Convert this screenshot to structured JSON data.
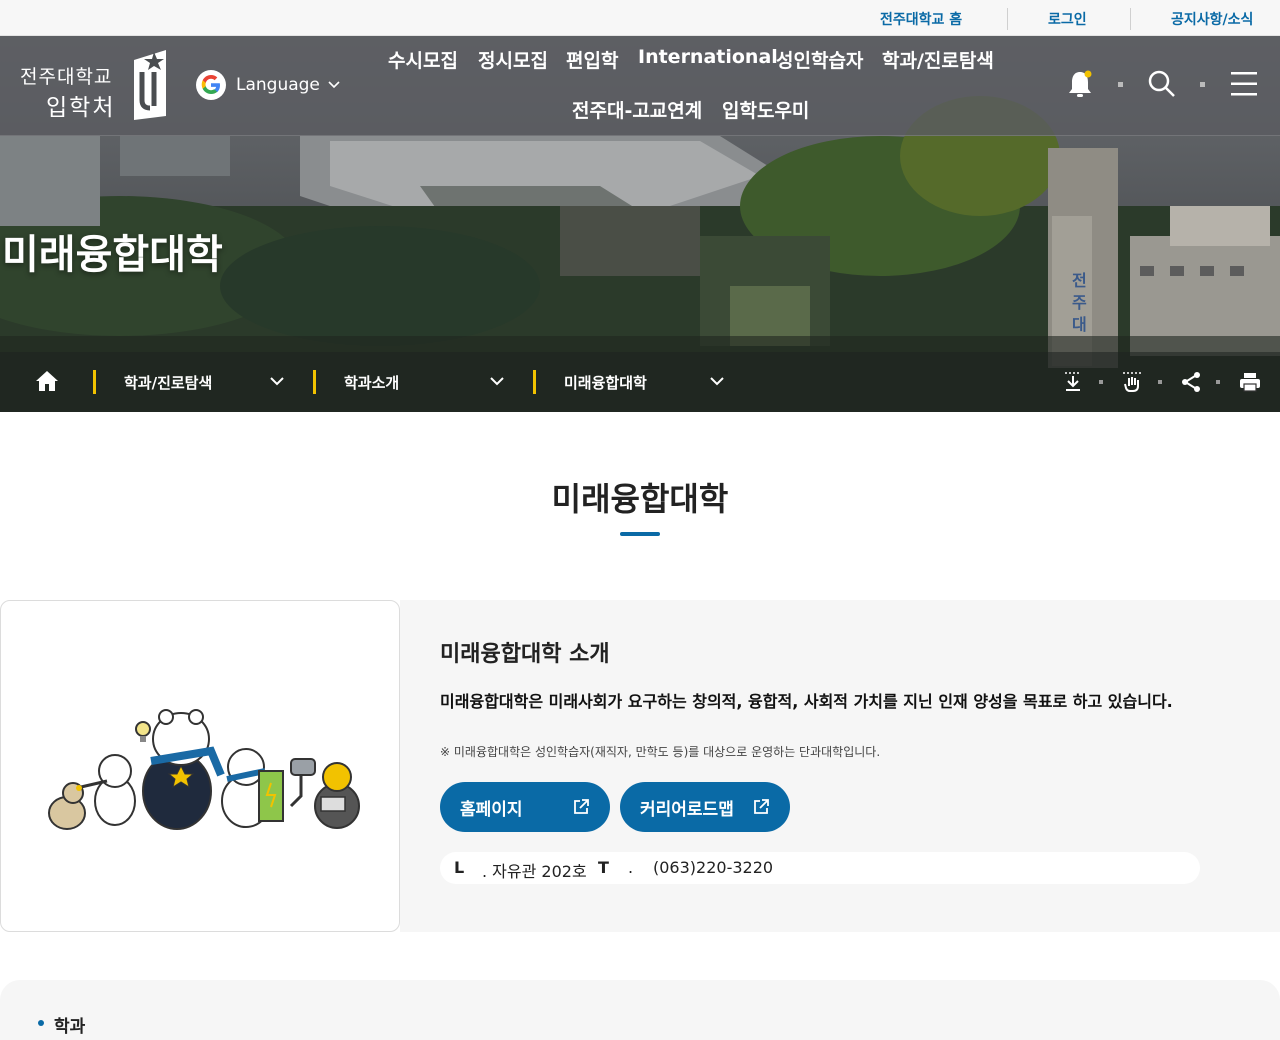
{
  "topbar": {
    "links": [
      "전주대학교 홈",
      "로그인",
      "공지사항/소식"
    ]
  },
  "header": {
    "logo_line1": "전주대학교",
    "logo_line2": "입학처",
    "language_label": "Language",
    "nav_row1": [
      "수시모집",
      "정시모집",
      "편입학",
      "International",
      "성인학습자",
      "학과/진로탐색"
    ],
    "nav_row2": [
      "전주대-고교연계",
      "입학도우미"
    ],
    "icons": [
      "bell-icon",
      "search-icon",
      "menu-icon"
    ]
  },
  "hero": {
    "title": "미래융합대학"
  },
  "breadcrumb": {
    "home_icon": "home-icon",
    "items": [
      "학과/진로탐색",
      "학과소개",
      "미래융합대학"
    ],
    "tools": [
      "download-icon",
      "touch-icon",
      "share-icon",
      "print-icon"
    ]
  },
  "main": {
    "title": "미래융합대학",
    "intro": {
      "heading": "미래융합대학 소개",
      "lead": "미래융합대학은 미래사회가 요구하는 창의적, 융합적, 사회적 가치를 지닌 인재 양성을 목표로 하고 있습니다.",
      "note": "※ 미래융합대학은 성인학습자(재직자, 만학도 등)를 대상으로 운영하는 단과대학입니다.",
      "buttons": [
        "홈페이지",
        "커리어로드맵"
      ],
      "location_key": "L",
      "location_value": ". 자유관 202호",
      "tel_key": "T",
      "tel_dot": ".",
      "tel_value": "(063)220-3220"
    },
    "next_section_label": "학과"
  },
  "colors": {
    "accent": "#0a6aa6",
    "crumb_bar": "#f2c200"
  }
}
